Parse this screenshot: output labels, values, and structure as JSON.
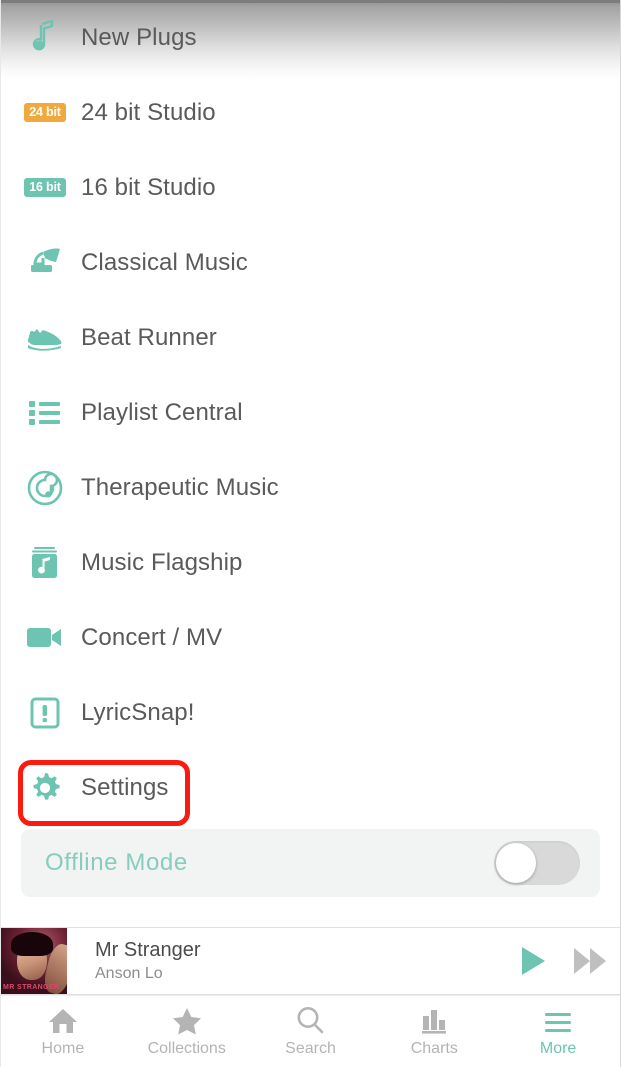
{
  "theme": {
    "accent": "#6dc4b0",
    "accent_light": "#87cdbd",
    "badge_orange": "#f0a93f",
    "text": "#5a5a5a",
    "muted": "#b4b4b4",
    "highlight": "#f91a10",
    "panel_bg": "#f2f3f3"
  },
  "menu": {
    "items": [
      {
        "label": "New Plugs",
        "icon": "music-note-icon"
      },
      {
        "label": "24 bit Studio",
        "icon": "24-bit-badge-icon",
        "badge": "24 bit"
      },
      {
        "label": "16 bit Studio",
        "icon": "16-bit-badge-icon",
        "badge": "16 bit"
      },
      {
        "label": "Classical Music",
        "icon": "gramophone-icon"
      },
      {
        "label": "Beat Runner",
        "icon": "sneaker-icon"
      },
      {
        "label": "Playlist Central",
        "icon": "list-icon"
      },
      {
        "label": "Therapeutic Music",
        "icon": "spiral-note-icon"
      },
      {
        "label": "Music Flagship",
        "icon": "music-book-icon"
      },
      {
        "label": "Concert / MV",
        "icon": "video-camera-icon"
      },
      {
        "label": "LyricSnap!",
        "icon": "exclamation-card-icon"
      },
      {
        "label": "Settings",
        "icon": "gear-icon"
      }
    ]
  },
  "offline": {
    "label": "Offline  Mode",
    "toggle_state": "off"
  },
  "now_playing": {
    "title": "Mr Stranger",
    "artist": "Anson Lo",
    "album_art_text": "MR STRANGER",
    "play_icon": "play-icon",
    "next_icon": "fast-forward-icon"
  },
  "tabbar": {
    "tabs": [
      {
        "label": "Home",
        "icon": "home-icon",
        "active": false
      },
      {
        "label": "Collections",
        "icon": "star-icon",
        "active": false
      },
      {
        "label": "Search",
        "icon": "search-icon",
        "active": false
      },
      {
        "label": "Charts",
        "icon": "bar-chart-icon",
        "active": false
      },
      {
        "label": "More",
        "icon": "hamburger-icon",
        "active": true
      }
    ]
  }
}
